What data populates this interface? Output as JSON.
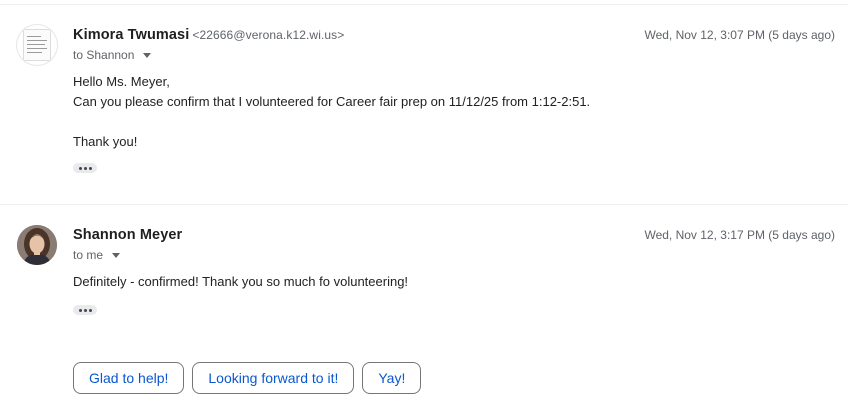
{
  "messages": [
    {
      "sender_name": "Kimora Twumasi",
      "sender_email": "<22666@verona.k12.wi.us>",
      "to_line": "to Shannon",
      "timestamp": "Wed, Nov 12, 3:07 PM (5 days ago)",
      "body": "Hello Ms. Meyer,\nCan you please confirm that I volunteered for Career fair prep on 11/12/25 from 1:12-2:51.\n\nThank you!",
      "avatar_icon": "handwritten-note-avatar"
    },
    {
      "sender_name": "Shannon Meyer",
      "to_line": "to me",
      "timestamp": "Wed, Nov 12, 3:17 PM (5 days ago)",
      "body": "Definitely - confirmed! Thank you so much fo volunteering!",
      "avatar_icon": "profile-photo-avatar"
    }
  ],
  "smart_replies": [
    "Glad to help!",
    "Looking forward to it!",
    "Yay!"
  ],
  "colors": {
    "accent": "#0b57d0",
    "secondary_text": "#5f6368",
    "divider": "#eeeeee"
  }
}
